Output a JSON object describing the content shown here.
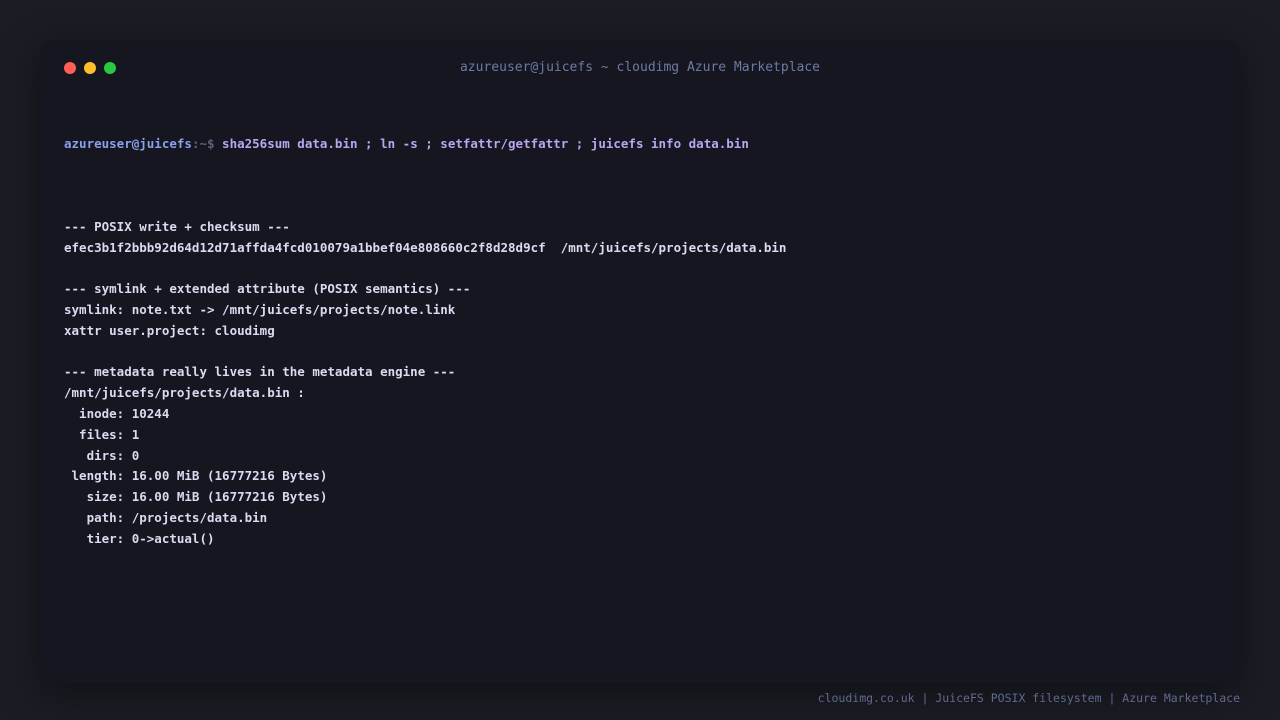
{
  "window": {
    "title": "azureuser@juicefs ~ cloudimg Azure Marketplace",
    "controls": [
      "close",
      "minimize",
      "maximize"
    ]
  },
  "prompt": {
    "user_host": "azureuser@juicefs",
    "separator": ":~$ ",
    "command": "sha256sum data.bin ; ln -s ; setfattr/getfattr ; juicefs info data.bin"
  },
  "output": [
    "",
    "--- POSIX write + checksum ---",
    "efec3b1f2bbb92d64d12d71affda4fcd010079a1bbef04e808660c2f8d28d9cf  /mnt/juicefs/projects/data.bin",
    "",
    "--- symlink + extended attribute (POSIX semantics) ---",
    "symlink: note.txt -> /mnt/juicefs/projects/note.link",
    "xattr user.project: cloudimg",
    "",
    "--- metadata really lives in the metadata engine ---",
    "/mnt/juicefs/projects/data.bin :",
    "  inode: 10244",
    "  files: 1",
    "   dirs: 0",
    " length: 16.00 MiB (16777216 Bytes)",
    "   size: 16.00 MiB (16777216 Bytes)",
    "   path: /projects/data.bin",
    "   tier: 0->actual()"
  ],
  "footer": "cloudimg.co.uk | JuiceFS POSIX filesystem | Azure Marketplace",
  "colors": {
    "background": "#1c1c25",
    "terminal": "#161620",
    "text": "#d8dcf0",
    "prompt_user": "#8aa0e8",
    "prompt_command": "#b8a6f0",
    "close": "#ff5f56",
    "minimize": "#ffbd2e",
    "maximize": "#27c93f"
  }
}
